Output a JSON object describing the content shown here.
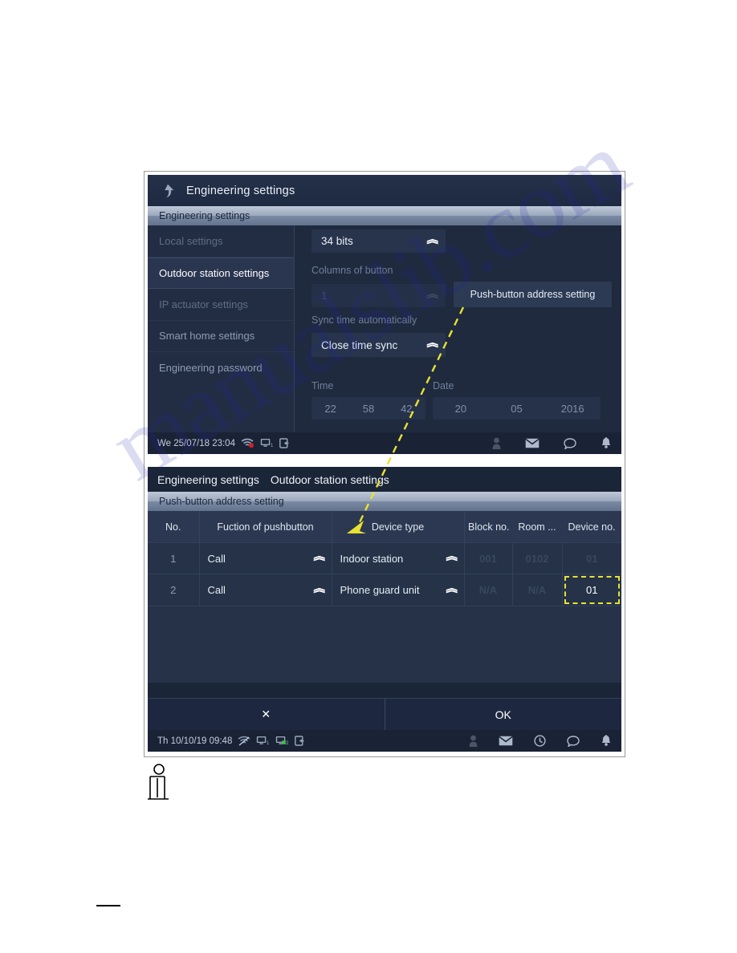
{
  "colors": {
    "screen_bg": "#1b2538",
    "sidebar_bg": "#222d44",
    "accent_highlight": "#e8e231",
    "band_light": "#bfc8d8",
    "text_primary": "#eaf0f8",
    "text_muted": "#6f7e98"
  },
  "watermark": {
    "text": "manualslib.com"
  },
  "top_screen": {
    "title_bar": {
      "back_icon": "up-arrow-icon",
      "title": "Engineering settings"
    },
    "section_band": {
      "label": "Engineering settings"
    },
    "sidebar": {
      "items": [
        {
          "label": "Local settings",
          "state": "dim"
        },
        {
          "label": "Outdoor station settings",
          "state": "active"
        },
        {
          "label": "IP actuator settings",
          "state": "dim"
        },
        {
          "label": "Smart home settings",
          "state": "normal"
        },
        {
          "label": "Engineering password",
          "state": "normal"
        }
      ]
    },
    "content": {
      "bits_dropdown": {
        "value": "34 bits",
        "icon": "chevron-down-icon"
      },
      "columns_label": "Columns of button",
      "columns_dropdown": {
        "value": "1",
        "icon": "chevron-down-icon"
      },
      "sync_label": "Sync time automatically",
      "sync_dropdown": {
        "value": "Close time sync",
        "icon": "chevron-down-icon"
      },
      "push_button_address": "Push-button address setting",
      "time_label": "Time",
      "time_values": [
        "22",
        "58",
        "42"
      ],
      "date_label": "Date",
      "date_values": [
        "20",
        "05",
        "2016"
      ]
    },
    "status_bar": {
      "datetime": "We 25/07/18  23:04",
      "left_icons": [
        "wifi-alert-icon",
        "monitor-1-icon",
        "logout-icon"
      ],
      "right_icons": [
        "person-icon",
        "envelope-icon",
        "speech-bubble-icon",
        "bell-icon"
      ]
    }
  },
  "bottom_screen": {
    "breadcrumb": [
      "Engineering settings",
      "Outdoor station settings"
    ],
    "section_band": {
      "label": "Push-button address setting"
    },
    "table": {
      "headers": [
        "No.",
        "Fuction of pushbutton",
        "Device type",
        "Block no.",
        "Room ...",
        "Device no."
      ],
      "rows": [
        {
          "no": "1",
          "function": "Call",
          "device_type": "Indoor station",
          "block_no": "001",
          "room_no": "0102",
          "device_no": "01",
          "device_no_highlighted": false,
          "dimmed": true
        },
        {
          "no": "2",
          "function": "Call",
          "device_type": "Phone guard unit",
          "block_no": "N/A",
          "room_no": "N/A",
          "device_no": "01",
          "device_no_highlighted": true,
          "dimmed": false
        }
      ]
    },
    "actions": {
      "cancel_label": "✕",
      "ok_label": "OK"
    },
    "status_bar": {
      "datetime": "Th 10/10/19  09:48",
      "left_icons": [
        "wifi-off-icon",
        "monitor-1-icon",
        "monitor-2-icon",
        "logout-icon"
      ],
      "right_icons": [
        "person-icon",
        "envelope-icon",
        "clock-icon",
        "speech-bubble-icon",
        "bell-icon"
      ]
    }
  },
  "annotation": {
    "label": "Push-button address setting",
    "arrow_color": "#e8e231",
    "style": "dashed-arrow"
  }
}
